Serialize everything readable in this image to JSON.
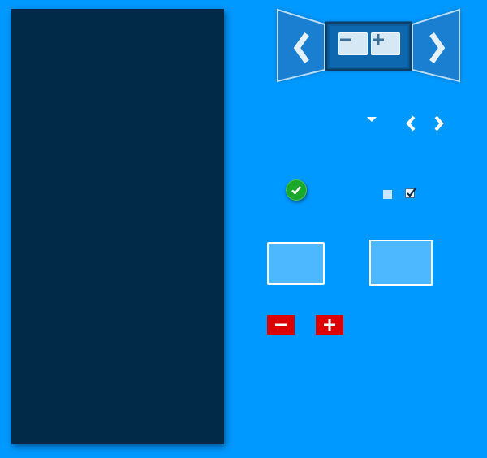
{
  "colors": {
    "background": "#0099ff",
    "panel": "#002a48",
    "accent_green": "#1aa82a",
    "accent_red": "#dd0000",
    "input_fill": "#4db8ff"
  },
  "icons": {
    "nav_prev": "chevron-left-icon",
    "nav_next": "chevron-right-icon",
    "zoom_out": "minus-icon",
    "zoom_in": "plus-icon",
    "dropdown": "caret-down-icon",
    "status_ok": "check-circle-icon",
    "decrement": "minus-icon",
    "increment": "plus-icon"
  },
  "controls": {
    "checkbox_checked": true
  }
}
